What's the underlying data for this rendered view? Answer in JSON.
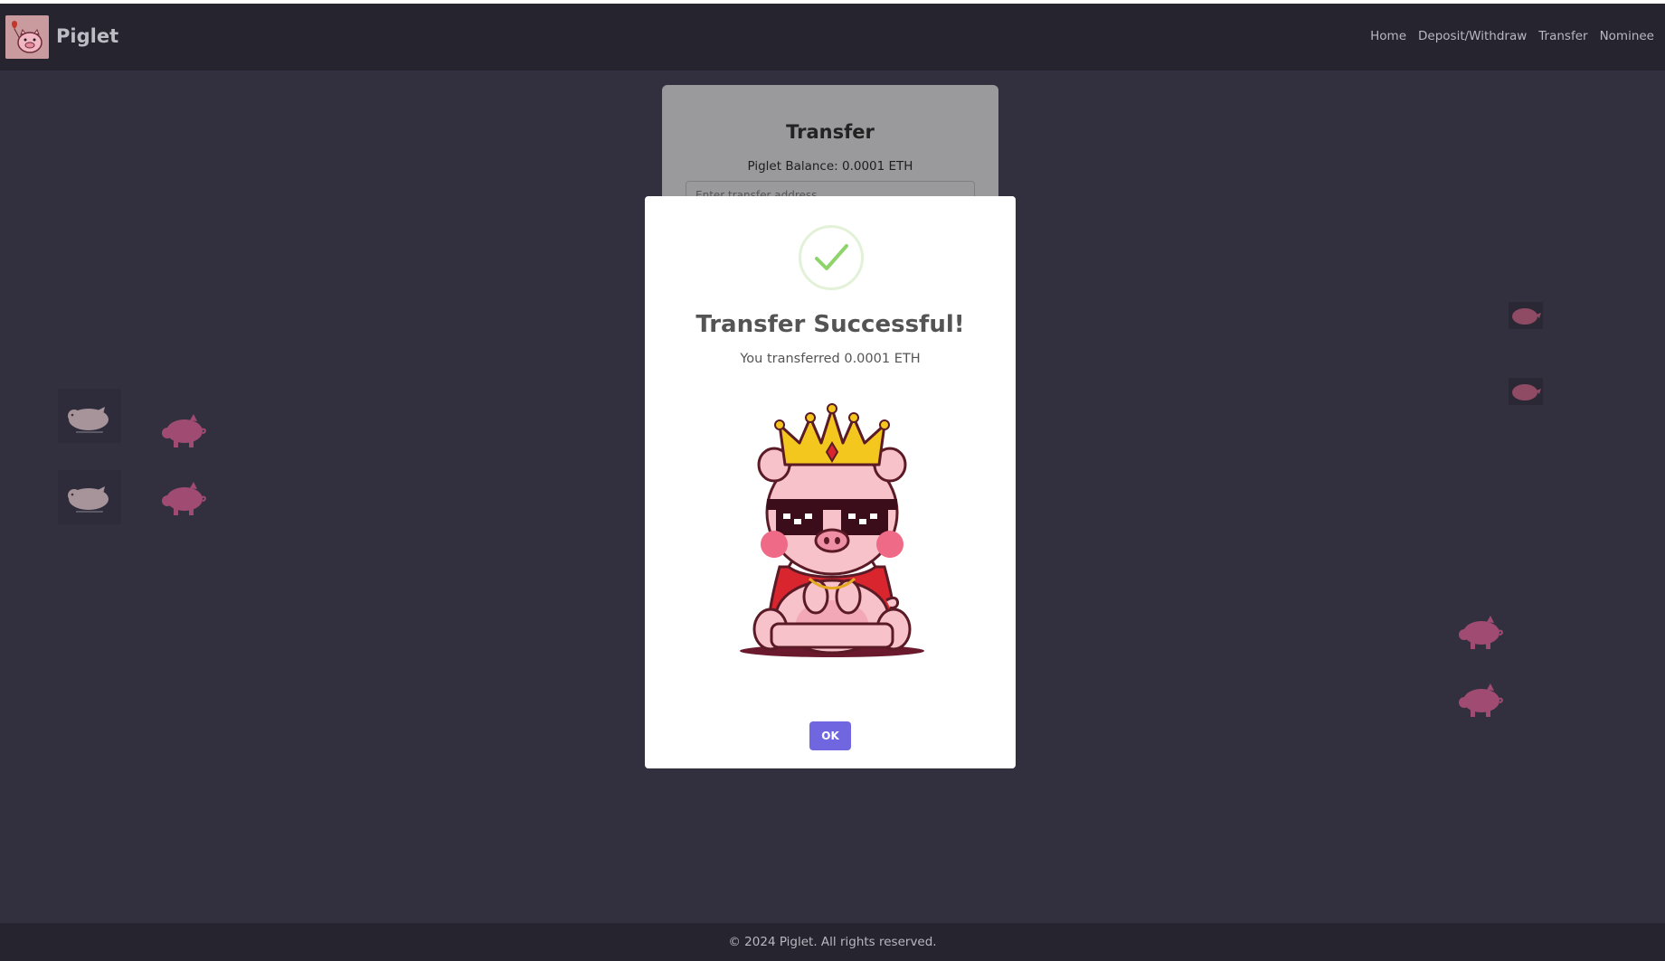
{
  "brand": {
    "name": "Piglet",
    "logo_icon": "pig-balloon-icon"
  },
  "nav": {
    "items": [
      {
        "label": "Home"
      },
      {
        "label": "Deposit/Withdraw"
      },
      {
        "label": "Transfer"
      },
      {
        "label": "Nominee"
      }
    ]
  },
  "card": {
    "title": "Transfer",
    "balance": "Piglet Balance: 0.0001 ETH",
    "address_placeholder": "Enter transfer address"
  },
  "modal": {
    "icon": "success-check-icon",
    "title": "Transfer Successful!",
    "message": "You transferred 0.0001 ETH",
    "image": "king-pig-sunglasses",
    "ok_label": "OK"
  },
  "footer": {
    "text": "© 2024 Piglet. All rights reserved."
  },
  "colors": {
    "page_bg": "#32303f",
    "navbar_bg": "#25242f",
    "confirm_button": "#7066e0",
    "success_green": "#8fd46b"
  }
}
